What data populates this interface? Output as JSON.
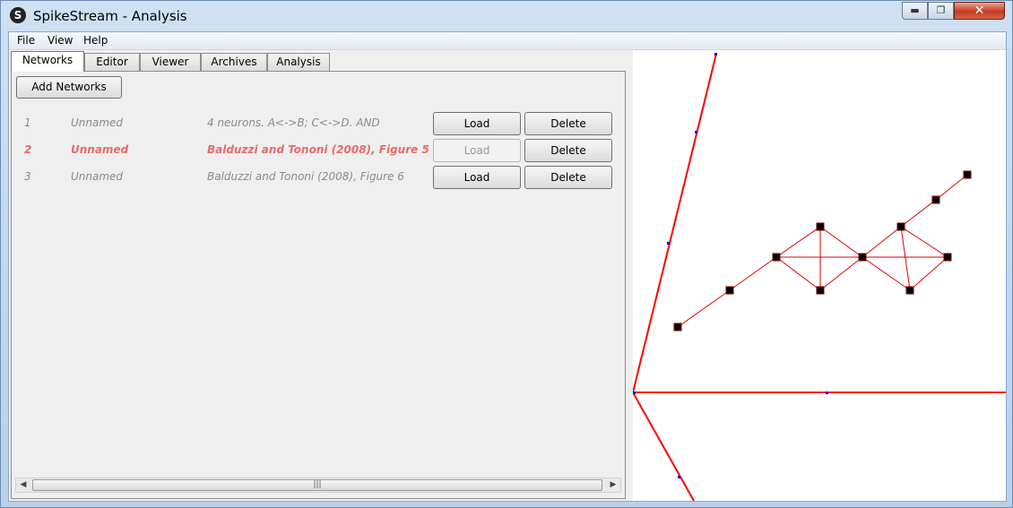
{
  "window": {
    "title": "SpikeStream - Analysis",
    "app_icon": "S"
  },
  "window_controls": {
    "minimize": "▬",
    "maximize": "❐",
    "close": "✕"
  },
  "menubar": [
    "File",
    "View",
    "Help"
  ],
  "tabs": [
    {
      "label": "Networks",
      "active": true
    },
    {
      "label": "Editor"
    },
    {
      "label": "Viewer"
    },
    {
      "label": "Archives"
    },
    {
      "label": "Analysis"
    }
  ],
  "networks_panel": {
    "add_label": "Add Networks",
    "load_label": "Load",
    "delete_label": "Delete",
    "rows": [
      {
        "id": "1",
        "name": "Unnamed",
        "description": "4 neurons. A<->B; C<->D. AND",
        "selected": false
      },
      {
        "id": "2",
        "name": "Unnamed",
        "description": "Balduzzi and Tononi (2008), Figure 5",
        "selected": true
      },
      {
        "id": "3",
        "name": "Unnamed",
        "description": "Balduzzi and Tononi (2008), Figure 6",
        "selected": false
      }
    ]
  },
  "scrollbar": {
    "left_arrow": "◀",
    "right_arrow": "▶",
    "grip": "|||"
  },
  "colors": {
    "selected_row": "#e86a6a",
    "network_line": "#ff0000",
    "neuron": "#000000"
  }
}
